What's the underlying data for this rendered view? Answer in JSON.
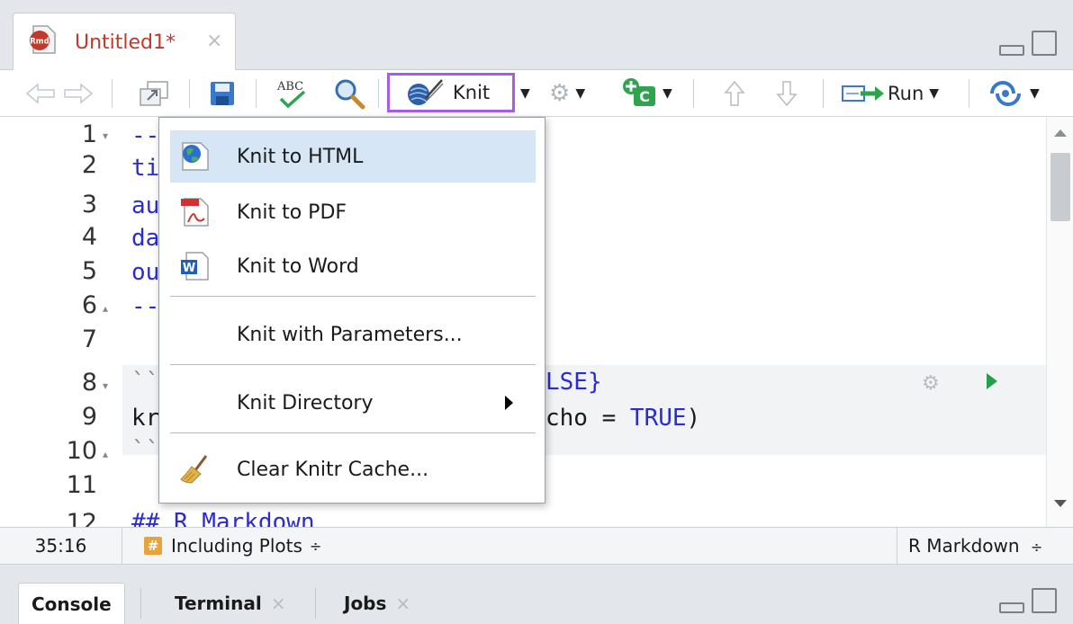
{
  "source_tab": {
    "icon": "rmd-file-icon",
    "icon_text": "Rmd",
    "title": "Untitled1*",
    "close": "×"
  },
  "toolbar": {
    "knit_label": "Knit",
    "run_label": "Run",
    "spellcheck_text": "ABC",
    "insert_chunk_text": "C"
  },
  "editor": {
    "line_numbers": [
      "1",
      "2",
      "3",
      "4",
      "5",
      "6",
      "7",
      "8",
      "9",
      "10",
      "11",
      "12"
    ],
    "visible_code": {
      "l1": "--",
      "l2": "ti",
      "l3": "au",
      "l4": "da",
      "l5": "ou",
      "l6": "--",
      "l8": "LSE}",
      "l8_prefix": "``",
      "l9_prefix": "kr",
      "l9_suffix_a": "cho = ",
      "l9_suffix_b": "TRUE",
      "l9_suffix_c": ")",
      "l10": "``",
      "l12": "## R Markdown"
    }
  },
  "knit_menu": {
    "items": [
      {
        "label": "Knit to HTML",
        "icon": "html-globe-icon"
      },
      {
        "label": "Knit to PDF",
        "icon": "pdf-icon"
      },
      {
        "label": "Knit to Word",
        "icon": "word-icon"
      },
      {
        "label": "Knit with Parameters..."
      },
      {
        "label": "Knit Directory",
        "submenu": true
      },
      {
        "label": "Clear Knitr Cache...",
        "icon": "broom-icon"
      }
    ],
    "word_icon_letter": "W"
  },
  "statusbar": {
    "position": "35:16",
    "section": "Including Plots",
    "section_caret": "÷",
    "mode": "R Markdown",
    "mode_caret": "÷",
    "hash": "#"
  },
  "lower_pane": {
    "tabs": [
      {
        "label": "Console",
        "active": true
      },
      {
        "label": "Terminal",
        "close": "×"
      },
      {
        "label": "Jobs",
        "close": "×"
      }
    ]
  },
  "colors": {
    "knit_highlight": "#a65ce8",
    "menu_hover": "#d7e6f5",
    "code_blue": "#2b2bd3",
    "tab_title": "#c0392b"
  }
}
